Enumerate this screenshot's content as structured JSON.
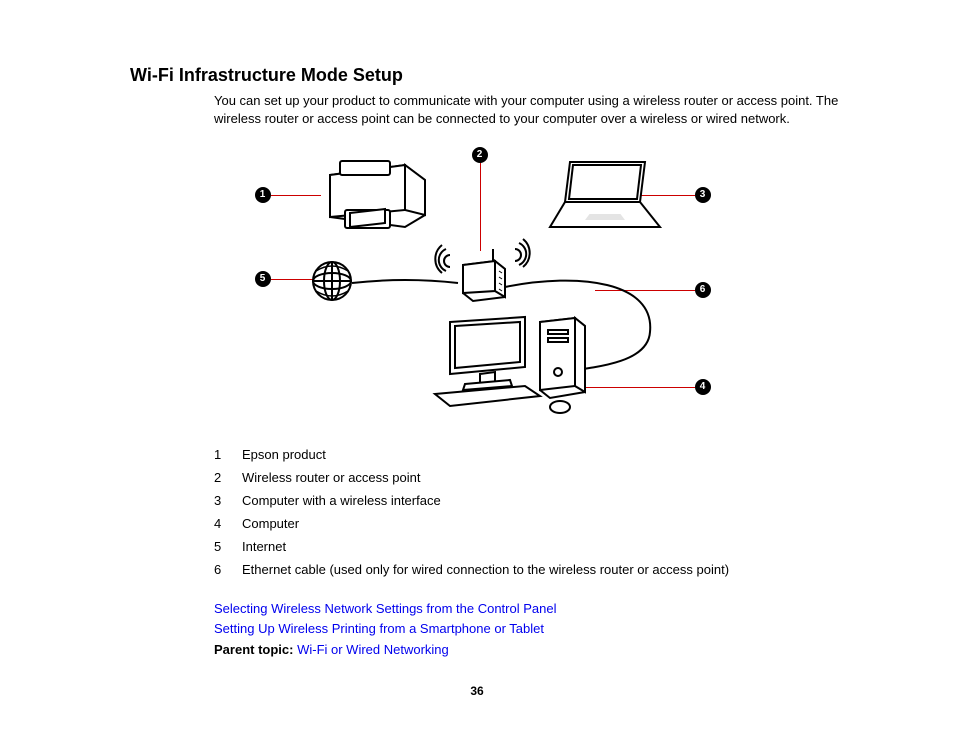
{
  "title": "Wi-Fi Infrastructure Mode Setup",
  "intro": "You can set up your product to communicate with your computer using a wireless router or access point. The wireless router or access point can be connected to your computer over a wireless or wired network.",
  "callouts": {
    "c1": "1",
    "c2": "2",
    "c3": "3",
    "c4": "4",
    "c5": "5",
    "c6": "6"
  },
  "legend": [
    {
      "n": "1",
      "t": "Epson product"
    },
    {
      "n": "2",
      "t": "Wireless router or access point"
    },
    {
      "n": "3",
      "t": "Computer with a wireless interface"
    },
    {
      "n": "4",
      "t": "Computer"
    },
    {
      "n": "5",
      "t": "Internet"
    },
    {
      "n": "6",
      "t": "Ethernet cable (used only for wired connection to the wireless router or access point)"
    }
  ],
  "links": {
    "l1": "Selecting Wireless Network Settings from the Control Panel",
    "l2": "Setting Up Wireless Printing from a Smartphone or Tablet"
  },
  "parent": {
    "label": "Parent topic: ",
    "link": "Wi-Fi or Wired Networking"
  },
  "pagenum": "36"
}
